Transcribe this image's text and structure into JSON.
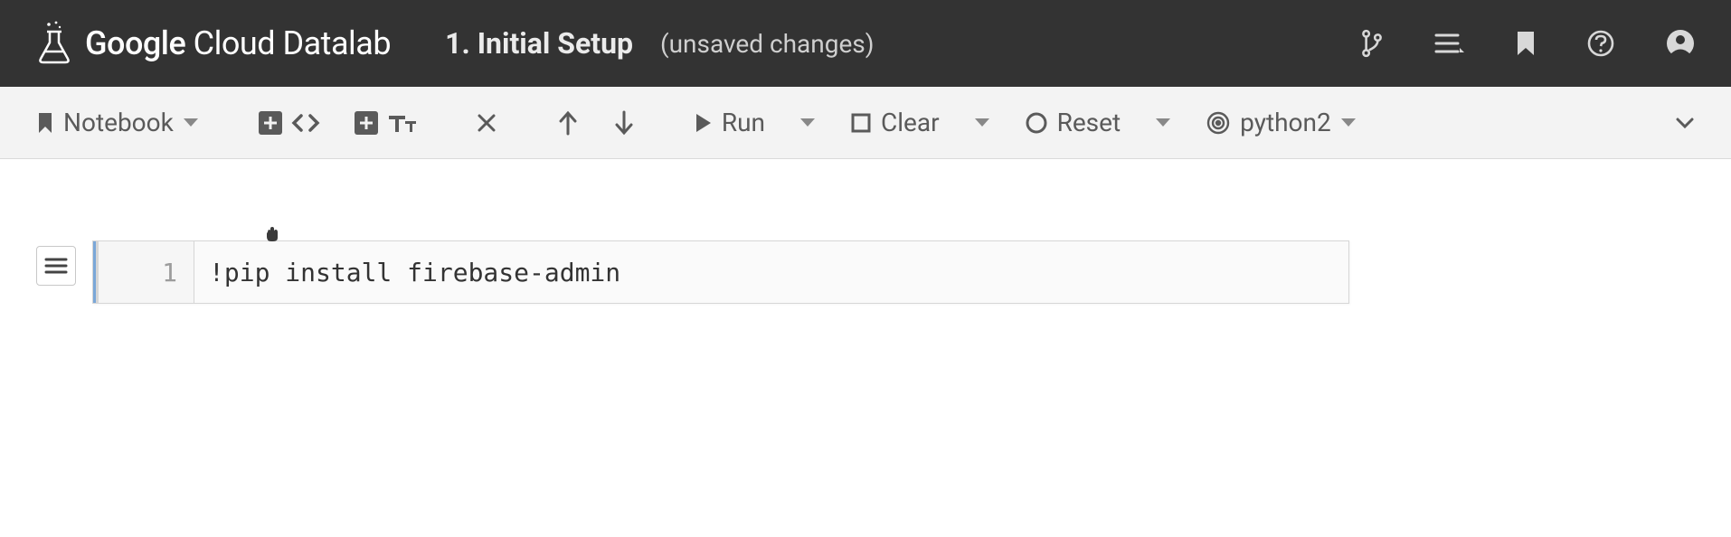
{
  "header": {
    "brand_bold": "Google",
    "brand_light": " Cloud Datalab",
    "title": "1. Initial Setup",
    "status": "(unsaved changes)"
  },
  "toolbar": {
    "notebook_label": "Notebook",
    "run_label": "Run",
    "clear_label": "Clear",
    "reset_label": "Reset",
    "kernel_label": "python2"
  },
  "cell": {
    "line_number": "1",
    "code": "!pip install firebase-admin"
  }
}
